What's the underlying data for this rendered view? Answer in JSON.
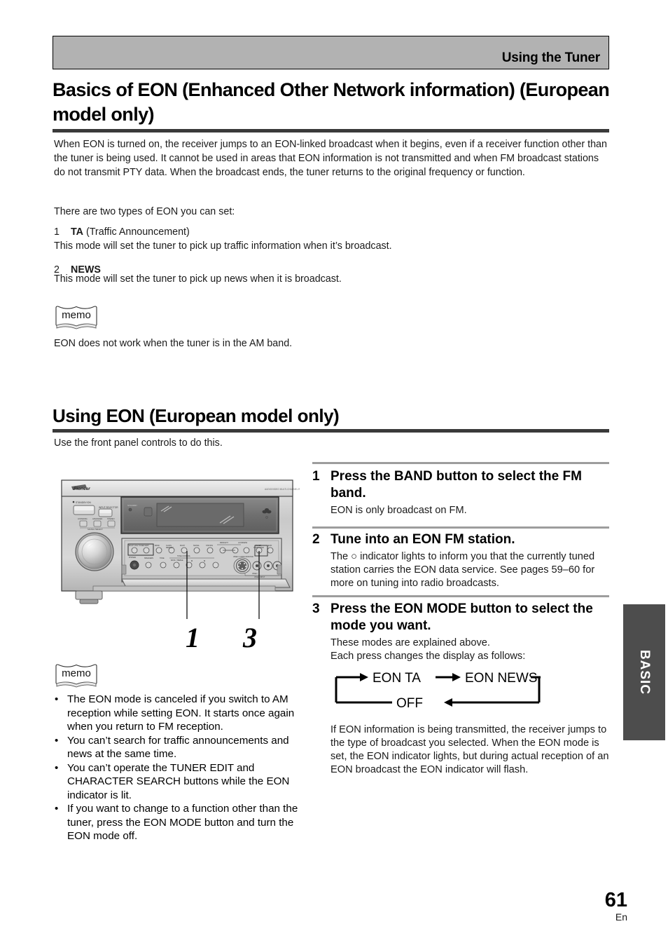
{
  "header": {
    "running_title": "Using the Tuner"
  },
  "sections": {
    "basics": {
      "title": "Basics of EON (Enhanced Other Network information) (European model only)",
      "intro": "When EON is turned on, the receiver jumps to an EON-linked broadcast when it begins, even if a receiver function other than the tuner is being used. It cannot be used in areas that EON information is not transmitted and when FM broadcast stations do not transmit PTY data. When the broadcast ends, the tuner returns to the original frequency or function.",
      "types_intro": "There are two types of EON you can set:",
      "type1": {
        "index": "1",
        "term": "TA",
        "term_suffix": " (Traffic Announcement)",
        "description": "This mode will set the tuner to pick up traffic information when it’s broadcast."
      },
      "type2": {
        "index": "2",
        "term": "NEWS",
        "term_suffix": "",
        "description": "This mode will set the tuner to pick up news when it is broadcast."
      },
      "memo_label": "memo",
      "memo_text": "EON does not work when the tuner is in the AM band."
    },
    "using_eon": {
      "title": "Using EON (European model only)",
      "intro": "Use the front panel controls to do this.",
      "figure": {
        "brand": "Pioneer",
        "callouts": [
          "1",
          "3"
        ]
      },
      "memo_label": "memo",
      "memo_bullets": [
        "The EON mode is canceled if you switch to AM reception while setting EON. It starts once again when you return to FM reception.",
        "You can’t search for traffic announcements and news at the same time.",
        "You can’t operate the TUNER EDIT and CHARACTER SEARCH buttons while the EON indicator is lit.",
        "If you want to change to a function other than the tuner, press the EON MODE button and turn the EON mode off."
      ],
      "steps": [
        {
          "index": "1",
          "title": "Press the BAND button to select the FM band.",
          "body": "EON is only broadcast on FM."
        },
        {
          "index": "2",
          "title": "Tune into an EON FM station.",
          "body": "The ○ indicator lights to inform you that the currently tuned station carries the EON data service. See pages 59–60 for more on tuning into radio broadcasts."
        },
        {
          "index": "3",
          "title": "Press the EON MODE button to select the mode you want.",
          "body": "These modes are explained above.\nEach press changes the display as follows:"
        }
      ],
      "cycle_diagram": {
        "states": [
          "EON  TA",
          "EON  NEWS",
          "OFF"
        ]
      },
      "closing": "If EON information is being transmitted, the receiver jumps to the type of broadcast you selected. When the EON mode is set, the EON indicator lights, but during actual reception of an EON broadcast the EON indicator will flash."
    }
  },
  "side_tab": {
    "label": "BASIC"
  },
  "footer": {
    "page_number": "61",
    "language": "En"
  },
  "colors": {
    "header_bar": "#b2b2b2",
    "rule_dark": "#3a3a3a",
    "step_rule": "#9d9d9d",
    "side_tab": "#4d4d4d"
  }
}
